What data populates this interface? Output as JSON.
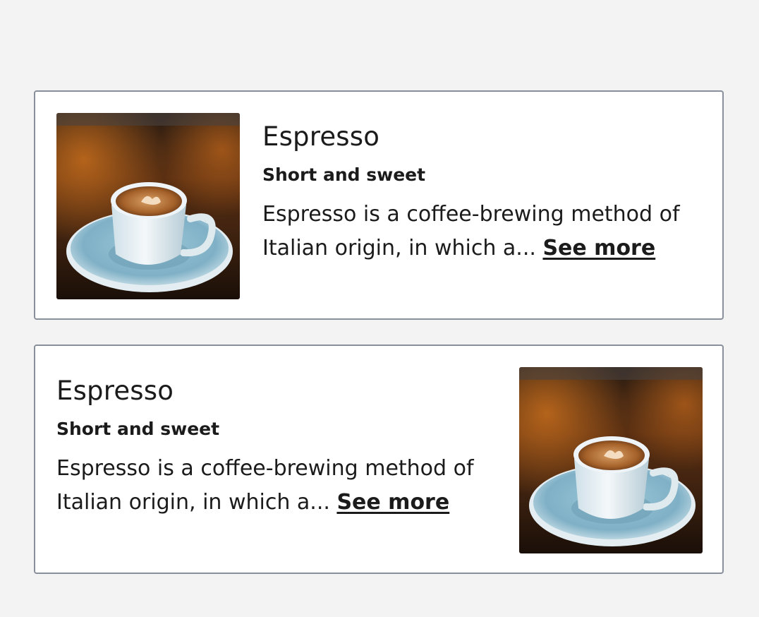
{
  "cards": [
    {
      "title": "Espresso",
      "subtitle": "Short and sweet",
      "description": "Espresso is a coffee-brewing method of Italian origin, in which a...",
      "link_label": "See more",
      "image_position": "left",
      "image_icon": "espresso-cup-photo"
    },
    {
      "title": "Espresso",
      "subtitle": "Short and sweet",
      "description": "Espresso is a coffee-brewing method of Italian origin, in which a...",
      "link_label": "See more",
      "image_position": "right",
      "image_icon": "espresso-cup-photo"
    }
  ],
  "colors": {
    "page_background": "#f3f3f3",
    "card_background": "#ffffff",
    "card_border": "#8a8f9c",
    "text": "#1b1b1b"
  }
}
